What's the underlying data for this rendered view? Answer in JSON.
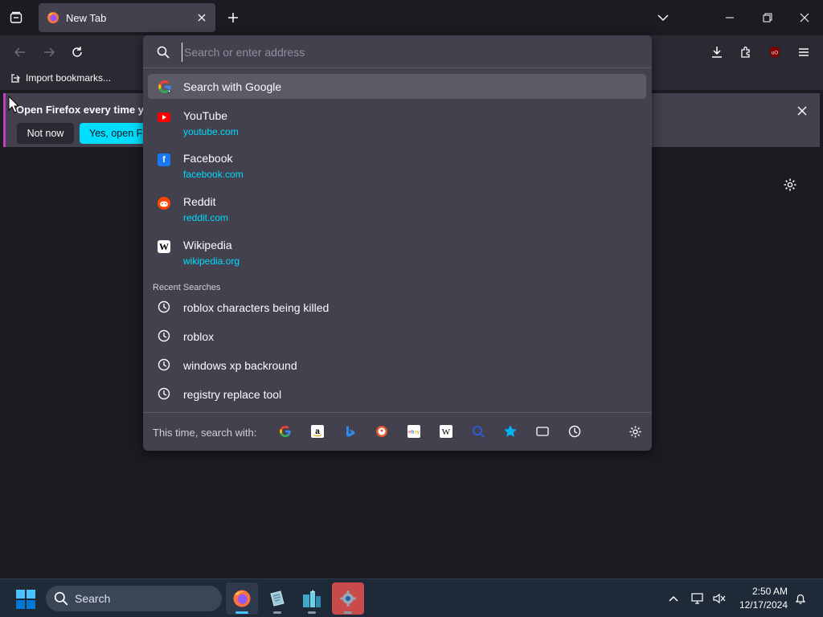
{
  "tab": {
    "title": "New Tab",
    "icon": "firefox-icon"
  },
  "toolbar": {
    "import_bookmarks": "Import bookmarks..."
  },
  "notification": {
    "message": "Open Firefox every time you",
    "not_now": "Not now",
    "yes_open": "Yes, open Firefox"
  },
  "urlbar": {
    "placeholder": "Search or enter address",
    "value": "",
    "google_suggestion": "Search with Google"
  },
  "top_sites": [
    {
      "name": "YouTube",
      "url": "youtube.com",
      "icon": "youtube-icon",
      "color": "#ff0000"
    },
    {
      "name": "Facebook",
      "url": "facebook.com",
      "icon": "facebook-icon",
      "color": "#1877f2"
    },
    {
      "name": "Reddit",
      "url": "reddit.com",
      "icon": "reddit-icon",
      "color": "#ff4500"
    },
    {
      "name": "Wikipedia",
      "url": "wikipedia.org",
      "icon": "wikipedia-icon",
      "color": "#ffffff"
    }
  ],
  "recent_searches": {
    "header": "Recent Searches",
    "items": [
      "roblox characters being killed",
      "roblox",
      "windows xp backround",
      "registry replace tool"
    ]
  },
  "one_off": {
    "label": "This time, search with:",
    "engines": [
      "google",
      "amazon",
      "bing",
      "duckduckgo",
      "ebay",
      "wikipedia",
      "search-bookmarks",
      "bookmarks",
      "tabs",
      "history"
    ]
  },
  "taskbar": {
    "search_label": "Search",
    "time": "2:50 AM",
    "date": "12/17/2024"
  },
  "colors": {
    "accent": "#00ddff",
    "panel": "#42414d",
    "background": "#1c1b22"
  }
}
